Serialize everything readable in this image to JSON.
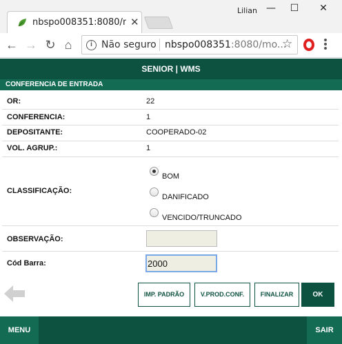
{
  "browser": {
    "tab_title": "nbspo008351:8080/mobi",
    "user_label": "Lilian",
    "security_label": "Não seguro",
    "url_host": "nbspo008351",
    "url_rest": ":8080/mo...",
    "window_minimize": "—",
    "window_maximize": "☐",
    "window_close": "✕",
    "tab_close": "✕",
    "back": "←",
    "forward": "→",
    "reload": "↻",
    "home": "⌂",
    "star": "☆",
    "info": "i"
  },
  "app": {
    "title": "SENIOR | WMS",
    "section": "CONFERENCIA DE ENTRADA"
  },
  "fields": {
    "or": {
      "label": "OR:",
      "value": "22"
    },
    "conferencia": {
      "label": "CONFERENCIA:",
      "value": "1"
    },
    "depositante": {
      "label": "DEPOSITANTE:",
      "value": "COOPERADO-02"
    },
    "vol_agrup": {
      "label": "VOL. AGRUP.:",
      "value": "1"
    },
    "classificacao": {
      "label": "CLASSIFICAÇÃO:",
      "options": [
        "BOM",
        "DANIFICADO",
        "VENCIDO/TRUNCADO"
      ],
      "selected": "BOM"
    },
    "observacao": {
      "label": "OBSERVAÇÃO:",
      "value": ""
    },
    "cod_barra": {
      "label": "Cód Barra:",
      "value": "2000"
    }
  },
  "actions": {
    "imp_padrao": "IMP. PADRÃO",
    "v_prod_conf": "V.PROD.CONF.",
    "finalizar": "FINALIZAR",
    "ok": "OK"
  },
  "footer": {
    "menu": "MENU",
    "sair": "SAIR"
  },
  "colors": {
    "header_green": "#0d5240",
    "section_green": "#136b54"
  }
}
